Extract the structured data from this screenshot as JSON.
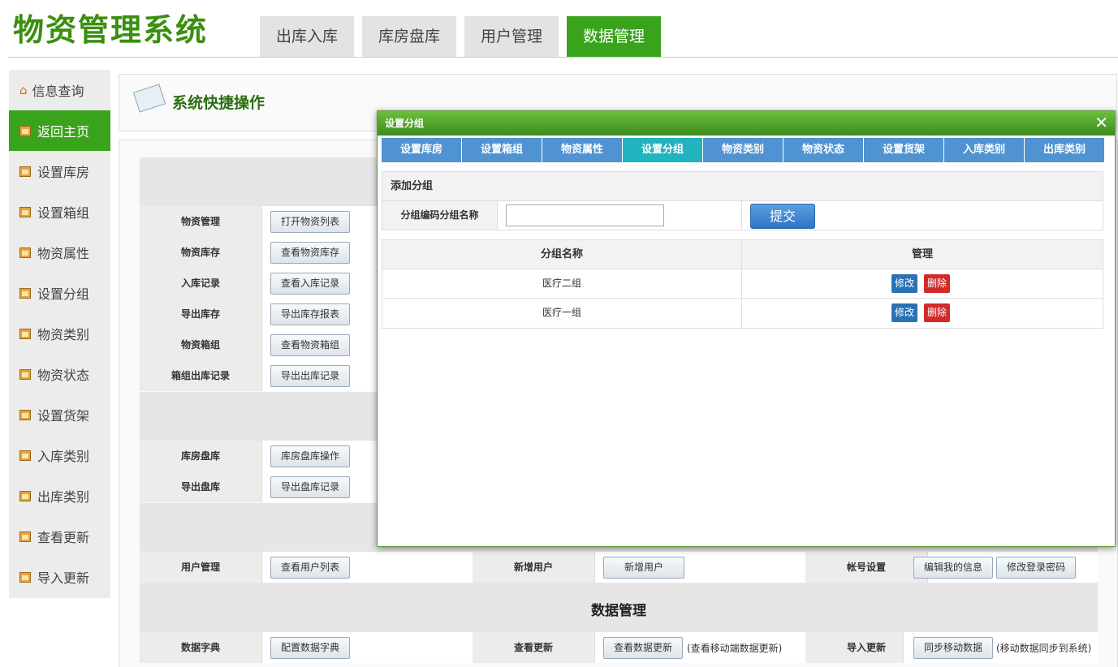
{
  "app": {
    "title": "物资管理系统"
  },
  "topnav": [
    "出库入库",
    "库房盘库",
    "用户管理",
    "数据管理"
  ],
  "sidebar": {
    "home_label": "信息查询",
    "items": [
      "返回主页",
      "设置库房",
      "设置箱组",
      "物资属性",
      "设置分组",
      "物资类别",
      "物资状态",
      "设置货架",
      "入库类别",
      "出库类别",
      "查看更新",
      "导入更新"
    ]
  },
  "quick": {
    "title": "系统快捷操作"
  },
  "grid": {
    "rows1": [
      {
        "label": "物资管理",
        "button": "打开物资列表"
      },
      {
        "label": "物资库存",
        "button": "查看物资库存"
      },
      {
        "label": "入库记录",
        "button": "查看入库记录"
      },
      {
        "label": "导出库存",
        "button": "导出库存报表"
      },
      {
        "label": "物资箱组",
        "button": "查看物资箱组"
      },
      {
        "label": "箱组出库记录",
        "button": "导出出库记录"
      }
    ],
    "rows2": [
      {
        "label": "库房盘库",
        "button": "库房盘库操作"
      },
      {
        "label": "导出盘库",
        "button": "导出盘库记录"
      }
    ],
    "user_row": {
      "label": "用户管理",
      "button": "查看用户列表",
      "label2": "新增用户",
      "button2": "新增用户",
      "label3": "帐号设置",
      "button3a": "编辑我的信息",
      "button3b": "修改登录密码"
    },
    "data_section_title": "数据管理",
    "data_row": {
      "label": "数据字典",
      "button": "配置数据字典",
      "label2": "查看更新",
      "button2": "查看数据更新",
      "note2": "(查看移动端数据更新)",
      "label3": "导入更新",
      "button3": "同步移动数据",
      "note3": "(移动数据同步到系统)"
    }
  },
  "modal": {
    "title": "设置分组",
    "close": "✕",
    "tabs": [
      "设置库房",
      "设置箱组",
      "物资属性",
      "设置分组",
      "物资类别",
      "物资状态",
      "设置货架",
      "入库类别",
      "出库类别"
    ],
    "active_tab": "设置分组",
    "form": {
      "title": "添加分组",
      "field_label": "分组编码分组名称",
      "field_value": "",
      "submit": "提交"
    },
    "list": {
      "headers": [
        "分组名称",
        "管理"
      ],
      "rows": [
        {
          "name": "医疗二组",
          "edit": "修改",
          "delete": "删除"
        },
        {
          "name": "医疗一组",
          "edit": "修改",
          "delete": "删除"
        }
      ]
    }
  },
  "colors": {
    "brand_green": "#3aa31c",
    "tab_blue": "#4f93d2",
    "tab_active": "#21b3be",
    "delete_red": "#d12b2b"
  }
}
